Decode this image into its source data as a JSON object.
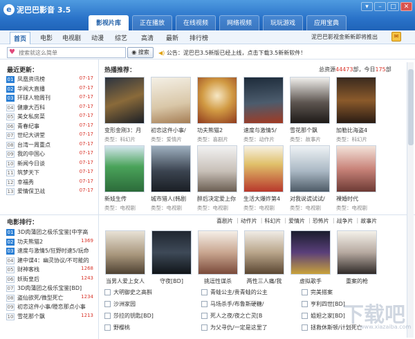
{
  "app": {
    "logo": "e",
    "title": "泥巴巴影音 3.5"
  },
  "main_tabs": [
    "影视片库",
    "正在播放",
    "在线视频",
    "网络视频",
    "玩玩游戏",
    "应用宝典"
  ],
  "window_buttons": [
    "▾",
    "–",
    "□",
    "✕"
  ],
  "categories": [
    "首页",
    "电影",
    "电视剧",
    "动漫",
    "综艺",
    "高清",
    "最新",
    "排行榜"
  ],
  "promo": "泥巴巴影视金新新即将推出",
  "search": {
    "placeholder": "搜索就这么简单",
    "button": "搜索"
  },
  "notice": "公告：泥巴巴3.5新版已经上线，点击下载3.5新新软件！",
  "latest": {
    "title": "最近更新：",
    "items": [
      {
        "num": "01",
        "name": "凤凰资讯榜",
        "date": "07-17"
      },
      {
        "num": "02",
        "name": "华闻大直播",
        "date": "07-17"
      },
      {
        "num": "03",
        "name": "环球人物周刊",
        "date": "07-17"
      },
      {
        "num": "04",
        "name": "健康大百科",
        "date": "07-17"
      },
      {
        "num": "05",
        "name": "美女私房菜",
        "date": "07-17"
      },
      {
        "num": "06",
        "name": "青春纪事",
        "date": "07-17"
      },
      {
        "num": "07",
        "name": "世纪大讲堂",
        "date": "07-17"
      },
      {
        "num": "08",
        "name": "台湾一周重点",
        "date": "07-17"
      },
      {
        "num": "09",
        "name": "我的中国心",
        "date": "07-17"
      },
      {
        "num": "10",
        "name": "新闻今日谈",
        "date": "07-17"
      },
      {
        "num": "11",
        "name": "筑梦天下",
        "date": "07-17"
      },
      {
        "num": "12",
        "name": "幸福秀",
        "date": "07-17"
      },
      {
        "num": "13",
        "name": "爱情保卫战",
        "date": "07-17"
      }
    ]
  },
  "hot": {
    "title": "热播推荐：",
    "stats_prefix": "总资源",
    "total": "44473",
    "stats_mid": "部，今日",
    "today": "175",
    "stats_suffix": "部",
    "items": [
      {
        "title": "变形金刚3：月",
        "type": "类型：科幻片"
      },
      {
        "title": "初恋这件小事/",
        "type": "类型：爱情片"
      },
      {
        "title": "功夫熊猫2",
        "type": "类型：喜剧片"
      },
      {
        "title": "速度与激情5/",
        "type": "类型：动作片"
      },
      {
        "title": "雪花那个飘",
        "type": "类型：故事片"
      },
      {
        "title": "加勒比海盗4",
        "type": "类型：科幻片"
      },
      {
        "title": "新妓生传",
        "type": "类型：电视剧"
      },
      {
        "title": "城市猎人(韩剧",
        "type": "类型：电视剧"
      },
      {
        "title": "醉后决定爱上你",
        "type": "类型：电视剧"
      },
      {
        "title": "生活大爆炸第4",
        "type": "类型：电视剧"
      },
      {
        "title": "对我说谎试试/",
        "type": "类型：电视剧"
      },
      {
        "title": "裸婚时代",
        "type": "类型：电视剧"
      }
    ]
  },
  "film_rank": {
    "title": "电影排行：",
    "items": [
      {
        "num": "01",
        "name": "3D肉蒲团之极乐宝鉴[中字高",
        "score": ""
      },
      {
        "num": "02",
        "name": "功夫熊猫2",
        "score": "1369"
      },
      {
        "num": "03",
        "name": "速度与激情5/狂野时速5/玩命",
        "score": ""
      },
      {
        "num": "04",
        "name": "建中谍4：幽灵协议/不可能的",
        "score": ""
      },
      {
        "num": "05",
        "name": "财神客栈",
        "score": "1268"
      },
      {
        "num": "06",
        "name": "妖街皇后",
        "score": "1243"
      },
      {
        "num": "07",
        "name": "3D肉蒲团之极乐宝鉴[BD]",
        "score": ""
      },
      {
        "num": "08",
        "name": "盗仙欲死/微型死亡",
        "score": "1234"
      },
      {
        "num": "09",
        "name": "初恋这件小事/瞪恋那点小事",
        "score": ""
      },
      {
        "num": "10",
        "name": "雪花那个飘",
        "score": "1213"
      }
    ]
  },
  "film_filters": [
    "喜剧片",
    "动作片",
    "科幻片",
    "爱情片",
    "恐怖片",
    "战争片",
    "故事片"
  ],
  "film_posters": [
    "当男人爱上女人",
    "守夜[BD]",
    "挑逗性谋杀",
    "两性三人痛/我",
    "虚拟歌手",
    "重案的枪"
  ],
  "film_text_links": [
    [
      "大明御史之高斟",
      "青蛙公主/贵青蛙的公主",
      "完美搭案"
    ],
    [
      "沙洲家园",
      "马场杀手/布鲁斯硬糖/",
      "亨利四世[BD]"
    ],
    [
      "莎拉的钥匙[BD]",
      "死人之夜/夜之亡灵[B",
      "姐妲之家[BD]"
    ],
    [
      "野樱桃",
      "为父寻仇/一定是这里了",
      "拯救休斯顿/计划死亡"
    ]
  ],
  "watermark": {
    "text": "下载吧",
    "url": "www.xiazaiba.com"
  }
}
